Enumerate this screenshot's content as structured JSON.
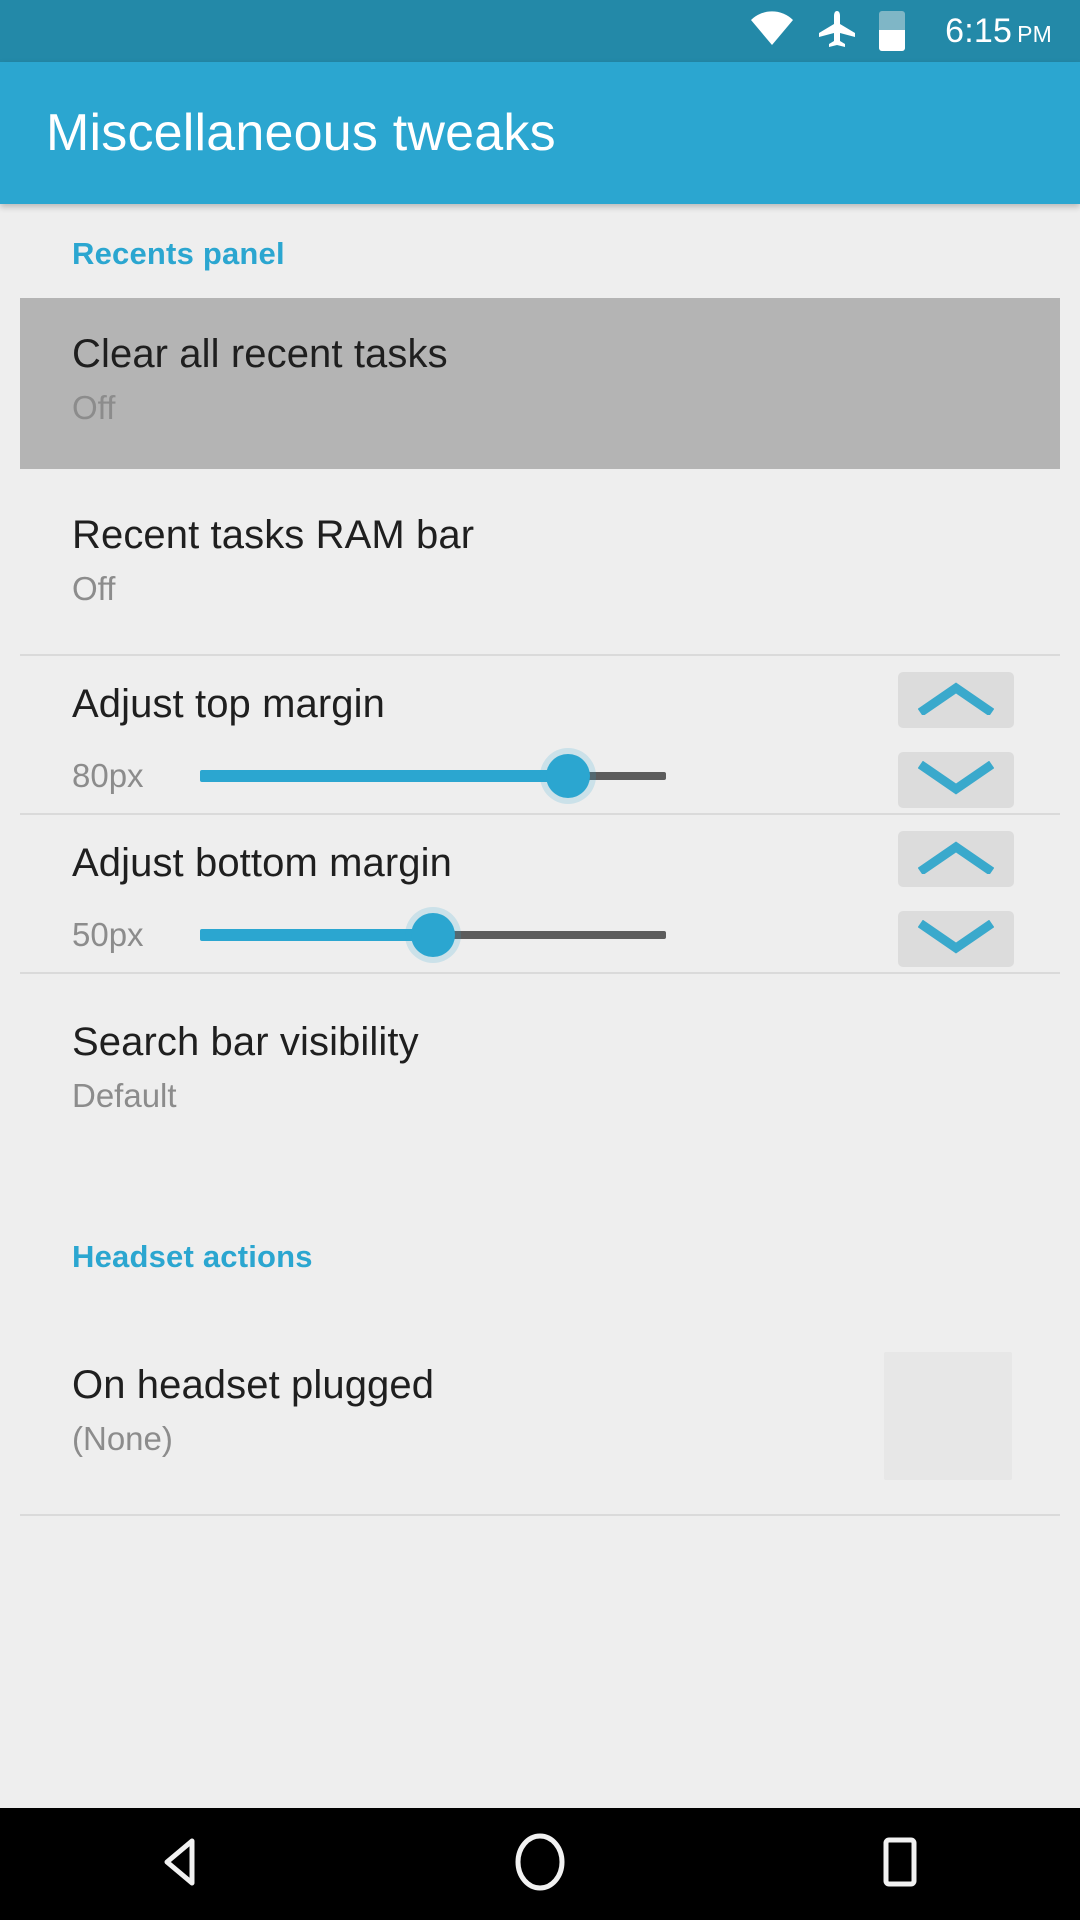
{
  "status_bar": {
    "time": "6:15",
    "meridiem": "PM",
    "icons": [
      "wifi-icon",
      "airplane-mode-icon",
      "battery-icon"
    ],
    "battery_level_percent": 52,
    "background_color": "#2389a8"
  },
  "app_bar": {
    "title": "Miscellaneous tweaks",
    "background_color": "#2ba6d0"
  },
  "sections": {
    "recents": {
      "header": "Recents panel",
      "rows": {
        "clear_all": {
          "title": "Clear all recent tasks",
          "subtitle": "Off",
          "selected": true
        },
        "ram_bar": {
          "title": "Recent tasks RAM bar",
          "subtitle": "Off"
        },
        "top_margin": {
          "title": "Adjust top margin",
          "value_label": "80px",
          "slider_percent": 79,
          "increment_icon": "chevron-up-icon",
          "decrement_icon": "chevron-down-icon"
        },
        "bottom_margin": {
          "title": "Adjust bottom margin",
          "value_label": "50px",
          "slider_percent": 50,
          "increment_icon": "chevron-up-icon",
          "decrement_icon": "chevron-down-icon"
        },
        "search_bar": {
          "title": "Search bar visibility",
          "subtitle": "Default"
        }
      }
    },
    "headset": {
      "header": "Headset actions",
      "rows": {
        "on_plugged": {
          "title": "On headset plugged",
          "subtitle": "(None)"
        }
      }
    }
  },
  "nav_bar": {
    "back": "back-icon",
    "home": "home-icon",
    "recents": "recents-icon",
    "background_color": "#000000"
  },
  "accent_color": "#2ba6d0"
}
